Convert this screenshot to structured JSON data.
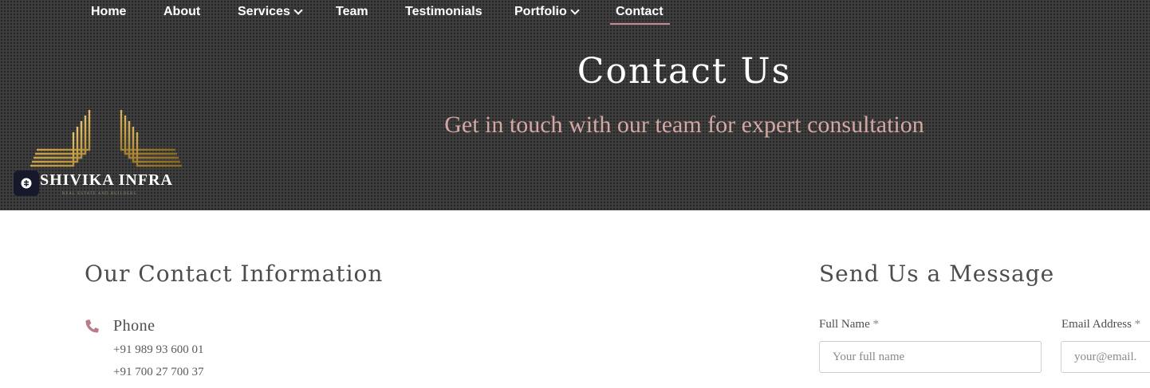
{
  "nav": {
    "items": [
      {
        "label": "Home"
      },
      {
        "label": "About"
      },
      {
        "label": "Services"
      },
      {
        "label": "Team"
      },
      {
        "label": "Testimonials"
      },
      {
        "label": "Portfolio"
      },
      {
        "label": "Contact"
      }
    ],
    "active": "Contact"
  },
  "brand": {
    "name": "SHIVIKA INFRA",
    "tagline": "REAL ESTATE AND BUILDERS"
  },
  "hero": {
    "title": "Contact Us",
    "subtitle": "Get in touch with our team for expert consultation"
  },
  "contact": {
    "title": "Our Contact Information",
    "phone_label": "Phone",
    "phones": [
      "+91 989 93 600 01",
      "+91 700 27 700 37"
    ]
  },
  "form": {
    "title": "Send Us a Message",
    "name_label": "Full Name",
    "name_placeholder": "Your full name",
    "email_label": "Email Address",
    "email_placeholder": "your@email.com",
    "required_mark": "*"
  },
  "colors": {
    "accent": "#c58a96",
    "hero_subtitle": "#d4a7a3",
    "logo_gold": "#c9a24b",
    "hero_bg": "#3a3a3a"
  },
  "icons": {
    "phone": "phone-icon",
    "chevron": "chevron-down-icon",
    "chat": "chat-widget-icon"
  }
}
